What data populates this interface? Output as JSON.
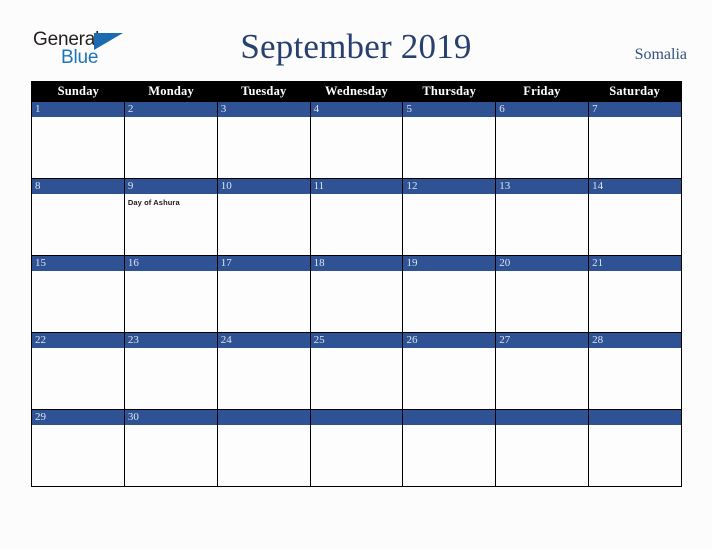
{
  "brand": {
    "name_part1": "General",
    "name_part2": "Blue",
    "triangle_icon": "triangle-icon",
    "colors": {
      "dark": "#231f20",
      "blue": "#1c75bc",
      "triangle": "#1c6bb0"
    }
  },
  "header": {
    "title": "September 2019",
    "region": "Somalia",
    "title_color": "#27406e",
    "region_color": "#31527f"
  },
  "calendar": {
    "month": "September",
    "year": "2019",
    "weekdays": [
      "Sunday",
      "Monday",
      "Tuesday",
      "Wednesday",
      "Thursday",
      "Friday",
      "Saturday"
    ],
    "header_bg": "#000000",
    "header_text_color": "#ffffff",
    "date_bar_bg": "#2f5294",
    "date_text_color": "#dde4f0",
    "cell_bg": "#fdfdfd",
    "border_color": "#000000",
    "weeks": [
      [
        {
          "day": "1",
          "events": []
        },
        {
          "day": "2",
          "events": []
        },
        {
          "day": "3",
          "events": []
        },
        {
          "day": "4",
          "events": []
        },
        {
          "day": "5",
          "events": []
        },
        {
          "day": "6",
          "events": []
        },
        {
          "day": "7",
          "events": []
        }
      ],
      [
        {
          "day": "8",
          "events": []
        },
        {
          "day": "9",
          "events": [
            "Day of Ashura"
          ]
        },
        {
          "day": "10",
          "events": []
        },
        {
          "day": "11",
          "events": []
        },
        {
          "day": "12",
          "events": []
        },
        {
          "day": "13",
          "events": []
        },
        {
          "day": "14",
          "events": []
        }
      ],
      [
        {
          "day": "15",
          "events": []
        },
        {
          "day": "16",
          "events": []
        },
        {
          "day": "17",
          "events": []
        },
        {
          "day": "18",
          "events": []
        },
        {
          "day": "19",
          "events": []
        },
        {
          "day": "20",
          "events": []
        },
        {
          "day": "21",
          "events": []
        }
      ],
      [
        {
          "day": "22",
          "events": []
        },
        {
          "day": "23",
          "events": []
        },
        {
          "day": "24",
          "events": []
        },
        {
          "day": "25",
          "events": []
        },
        {
          "day": "26",
          "events": []
        },
        {
          "day": "27",
          "events": []
        },
        {
          "day": "28",
          "events": []
        }
      ],
      [
        {
          "day": "29",
          "events": []
        },
        {
          "day": "30",
          "events": []
        },
        {
          "day": "",
          "events": []
        },
        {
          "day": "",
          "events": []
        },
        {
          "day": "",
          "events": []
        },
        {
          "day": "",
          "events": []
        },
        {
          "day": "",
          "events": []
        }
      ]
    ]
  }
}
